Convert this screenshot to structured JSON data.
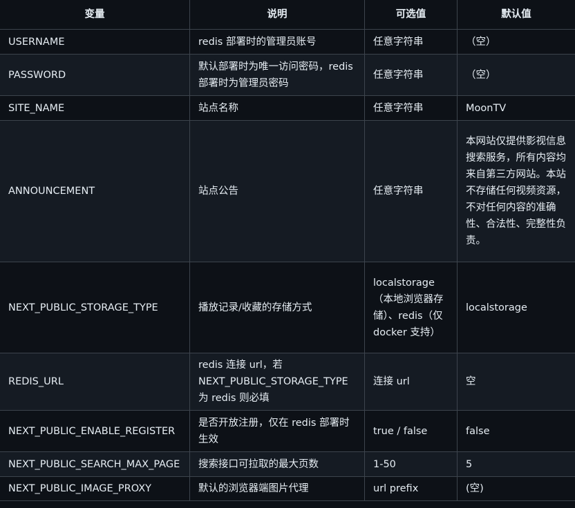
{
  "headers": {
    "variable": "变量",
    "description": "说明",
    "options": "可选值",
    "default": "默认值"
  },
  "rows": [
    {
      "variable": "USERNAME",
      "description": "redis 部署时的管理员账号",
      "options": "任意字符串",
      "default": "（空）"
    },
    {
      "variable": "PASSWORD",
      "description": "默认部署时为唯一访问密码，redis 部署时为管理员密码",
      "options": "任意字符串",
      "default": "（空）"
    },
    {
      "variable": "SITE_NAME",
      "description": "站点名称",
      "options": "任意字符串",
      "default": "MoonTV"
    },
    {
      "variable": "ANNOUNCEMENT",
      "description": "站点公告",
      "options": "任意字符串",
      "default": "本网站仅提供影视信息搜索服务，所有内容均来自第三方网站。本站不存储任何视频资源，不对任何内容的准确性、合法性、完整性负责。"
    },
    {
      "variable": "NEXT_PUBLIC_STORAGE_TYPE",
      "description": "播放记录/收藏的存储方式",
      "options": "localstorage（本地浏览器存储）、redis（仅 docker 支持）",
      "default": "localstorage"
    },
    {
      "variable": "REDIS_URL",
      "description": "redis 连接 url，若 NEXT_PUBLIC_STORAGE_TYPE 为 redis 则必填",
      "options": "连接 url",
      "default": "空"
    },
    {
      "variable": "NEXT_PUBLIC_ENABLE_REGISTER",
      "description": "是否开放注册，仅在 redis 部署时生效",
      "options": "true / false",
      "default": "false"
    },
    {
      "variable": "NEXT_PUBLIC_SEARCH_MAX_PAGE",
      "description": "搜索接口可拉取的最大页数",
      "options": "1-50",
      "default": "5"
    },
    {
      "variable": "NEXT_PUBLIC_IMAGE_PROXY",
      "description": "默认的浏览器端图片代理",
      "options": "url prefix",
      "default": "(空)"
    }
  ]
}
